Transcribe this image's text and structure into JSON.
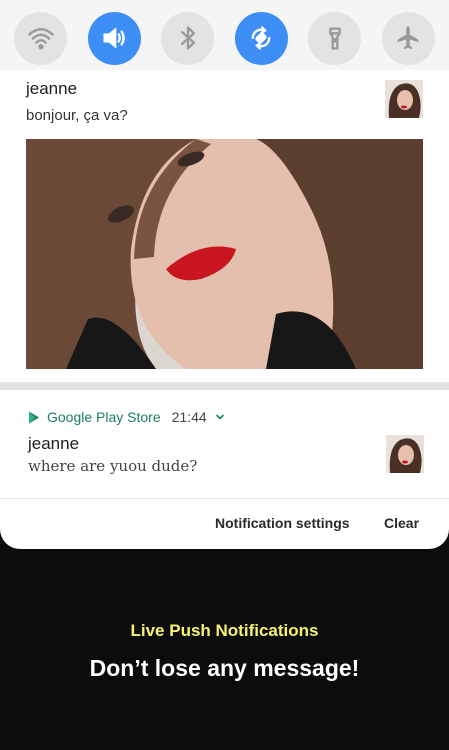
{
  "quick_settings": {
    "toggles": [
      {
        "icon": "wifi-icon",
        "state": "off"
      },
      {
        "icon": "sound-icon",
        "state": "on"
      },
      {
        "icon": "bluetooth-icon",
        "state": "off"
      },
      {
        "icon": "auto-rotate-icon",
        "state": "on"
      },
      {
        "icon": "flashlight-icon",
        "state": "off"
      },
      {
        "icon": "airplane-mode-icon",
        "state": "off"
      }
    ]
  },
  "notification_1": {
    "sender": "jeanne",
    "message": "bonjour, ça va?"
  },
  "notification_2": {
    "app_name": "Google Play Store",
    "time": "21:44",
    "sender": "jeanne",
    "message": "where are yuou dude?"
  },
  "actions": {
    "settings_label": "Notification settings",
    "clear_label": "Clear"
  },
  "promo": {
    "headline": "Live Push Notifications",
    "tagline": "Don’t lose any message!"
  },
  "colors": {
    "toggle_on": "#3e8ff5",
    "toggle_off": "#e3e3e3",
    "app_name": "#1a7f64",
    "headline": "#f7f36f"
  }
}
